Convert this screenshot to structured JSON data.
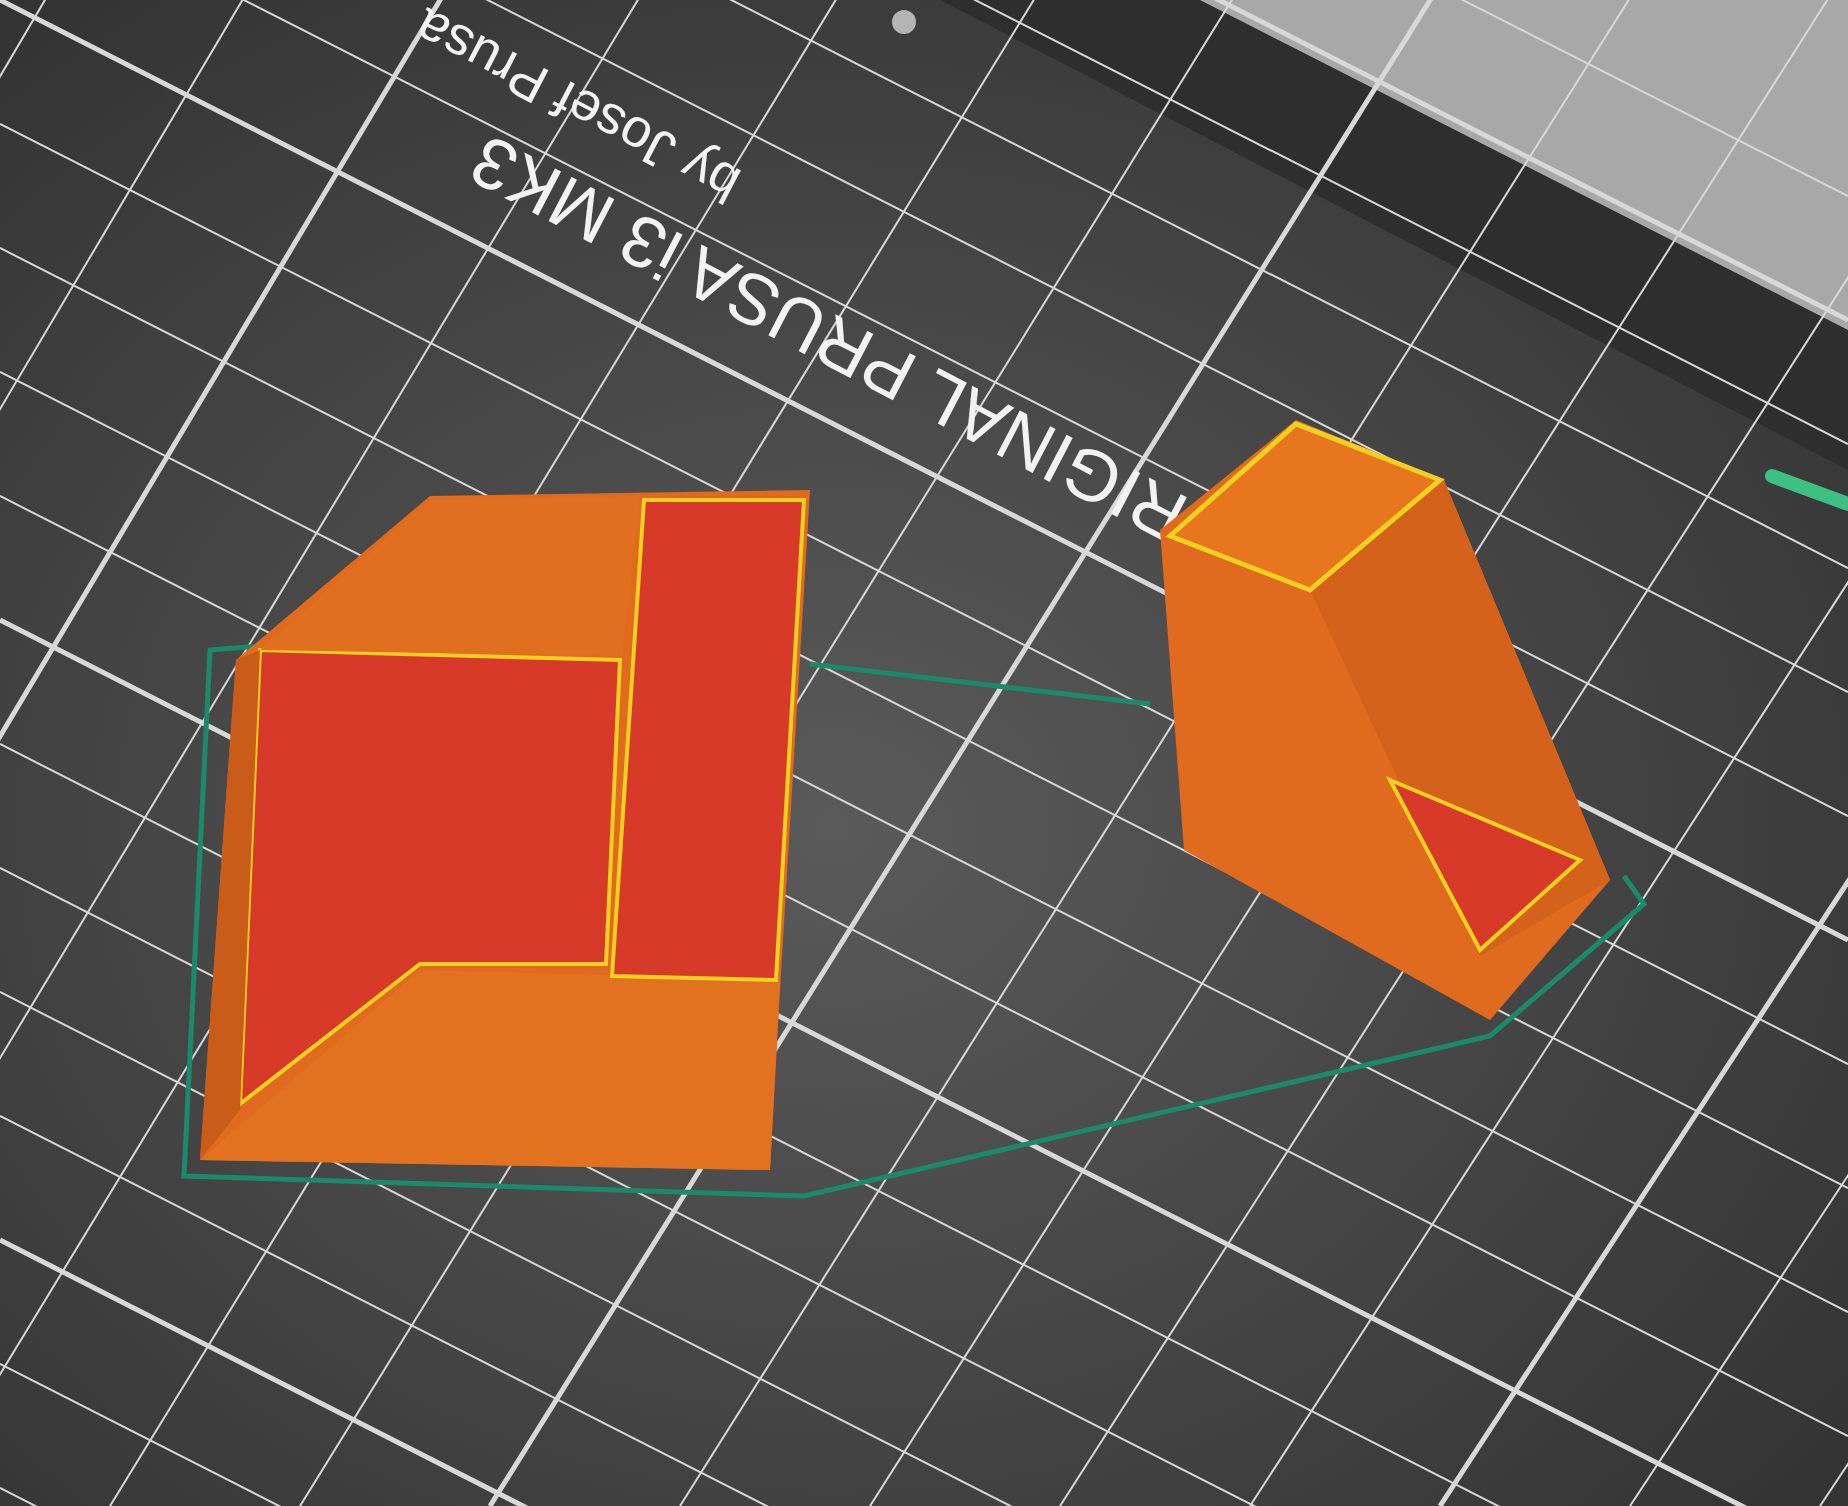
{
  "bed": {
    "label": "RIGINAL PRUSA i3 MK3",
    "sublabel": "by Josef Prusa"
  }
}
